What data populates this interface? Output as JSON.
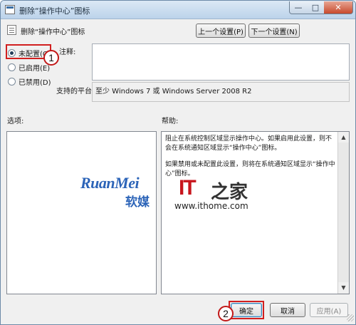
{
  "window": {
    "title": "删除“操作中心”图标",
    "minimize_glyph": "—",
    "maximize_glyph": "□",
    "close_glyph": "✕"
  },
  "header": {
    "policy_name": "删除“操作中心”图标",
    "prev_button": "上一个设置(P)",
    "next_button": "下一个设置(N)"
  },
  "state": {
    "options": [
      {
        "label": "未配置(C)",
        "checked": true
      },
      {
        "label": "已启用(E)",
        "checked": false
      },
      {
        "label": "已禁用(D)",
        "checked": false
      }
    ]
  },
  "comment": {
    "label": "注释:",
    "value": ""
  },
  "platform": {
    "label": "支持的平台:",
    "value": "至少 Windows 7 或 Windows Server 2008 R2"
  },
  "sections": {
    "options_label": "选项:",
    "help_label": "帮助:"
  },
  "help": {
    "paragraph1": "阻止在系统控制区域显示操作中心。如果启用此设置，则不会在系统通知区域显示“操作中心”图标。",
    "paragraph2": "如果禁用或未配置此设置，则将在系统通知区域显示“操作中心”图标。"
  },
  "scrollbar": {
    "up_glyph": "▲",
    "down_glyph": "▼"
  },
  "watermarks": {
    "ruanmei_en": "RuanMei",
    "ruanmei_cn": "软媒",
    "ithome_logo": "IT",
    "ithome_zhi": "之家",
    "ithome_url": "www.ithome.com"
  },
  "annotations": {
    "callout_1": "1",
    "callout_2": "2"
  },
  "footer": {
    "ok_button": "确定",
    "cancel_button": "取消",
    "apply_button": "应用(A)"
  },
  "colors": {
    "annotation_red": "#d11f1f",
    "title_gradient_top": "#dbe8f5",
    "title_gradient_bottom": "#bcd3ea",
    "close_button_red": "#c74a2d"
  }
}
